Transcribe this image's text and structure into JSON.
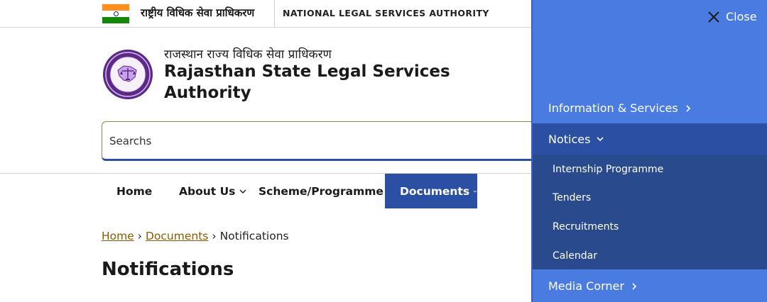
{
  "topbar": {
    "hindi_authority": "राष्ट्रीय विधिक सेवा प्राधिकरण",
    "english_authority": "NATIONAL LEGAL SERVICES AUTHORITY"
  },
  "site": {
    "hindi_name": "राजस्थान राज्य विधिक सेवा प्राधिकरण",
    "name": "Rajasthan State Legal Services Authority"
  },
  "search": {
    "placeholder": "Searchs"
  },
  "nav": {
    "home": "Home",
    "about": "About Us",
    "scheme": "Scheme/Programme",
    "documents": "Documents"
  },
  "breadcrumb": {
    "home": "Home",
    "documents": "Documents",
    "current": "Notifications"
  },
  "page": {
    "title": "Notifications"
  },
  "panel": {
    "close": "Close",
    "items": [
      "Information & Services",
      "Notices",
      "Media Corner"
    ],
    "notices_sub": [
      "Internship Programme",
      "Tenders",
      "Recruitments",
      "Calendar"
    ]
  },
  "colors": {
    "nav_active": "#2b4fa3",
    "panel_bg": "#4a7be0",
    "panel_submenu_bg": "#2a4a8e",
    "link": "#8a5a00"
  },
  "icons": [
    "india-flag-icon",
    "rslsa-seal-icon",
    "chevron-down-icon",
    "chevron-right-icon",
    "close-icon"
  ]
}
